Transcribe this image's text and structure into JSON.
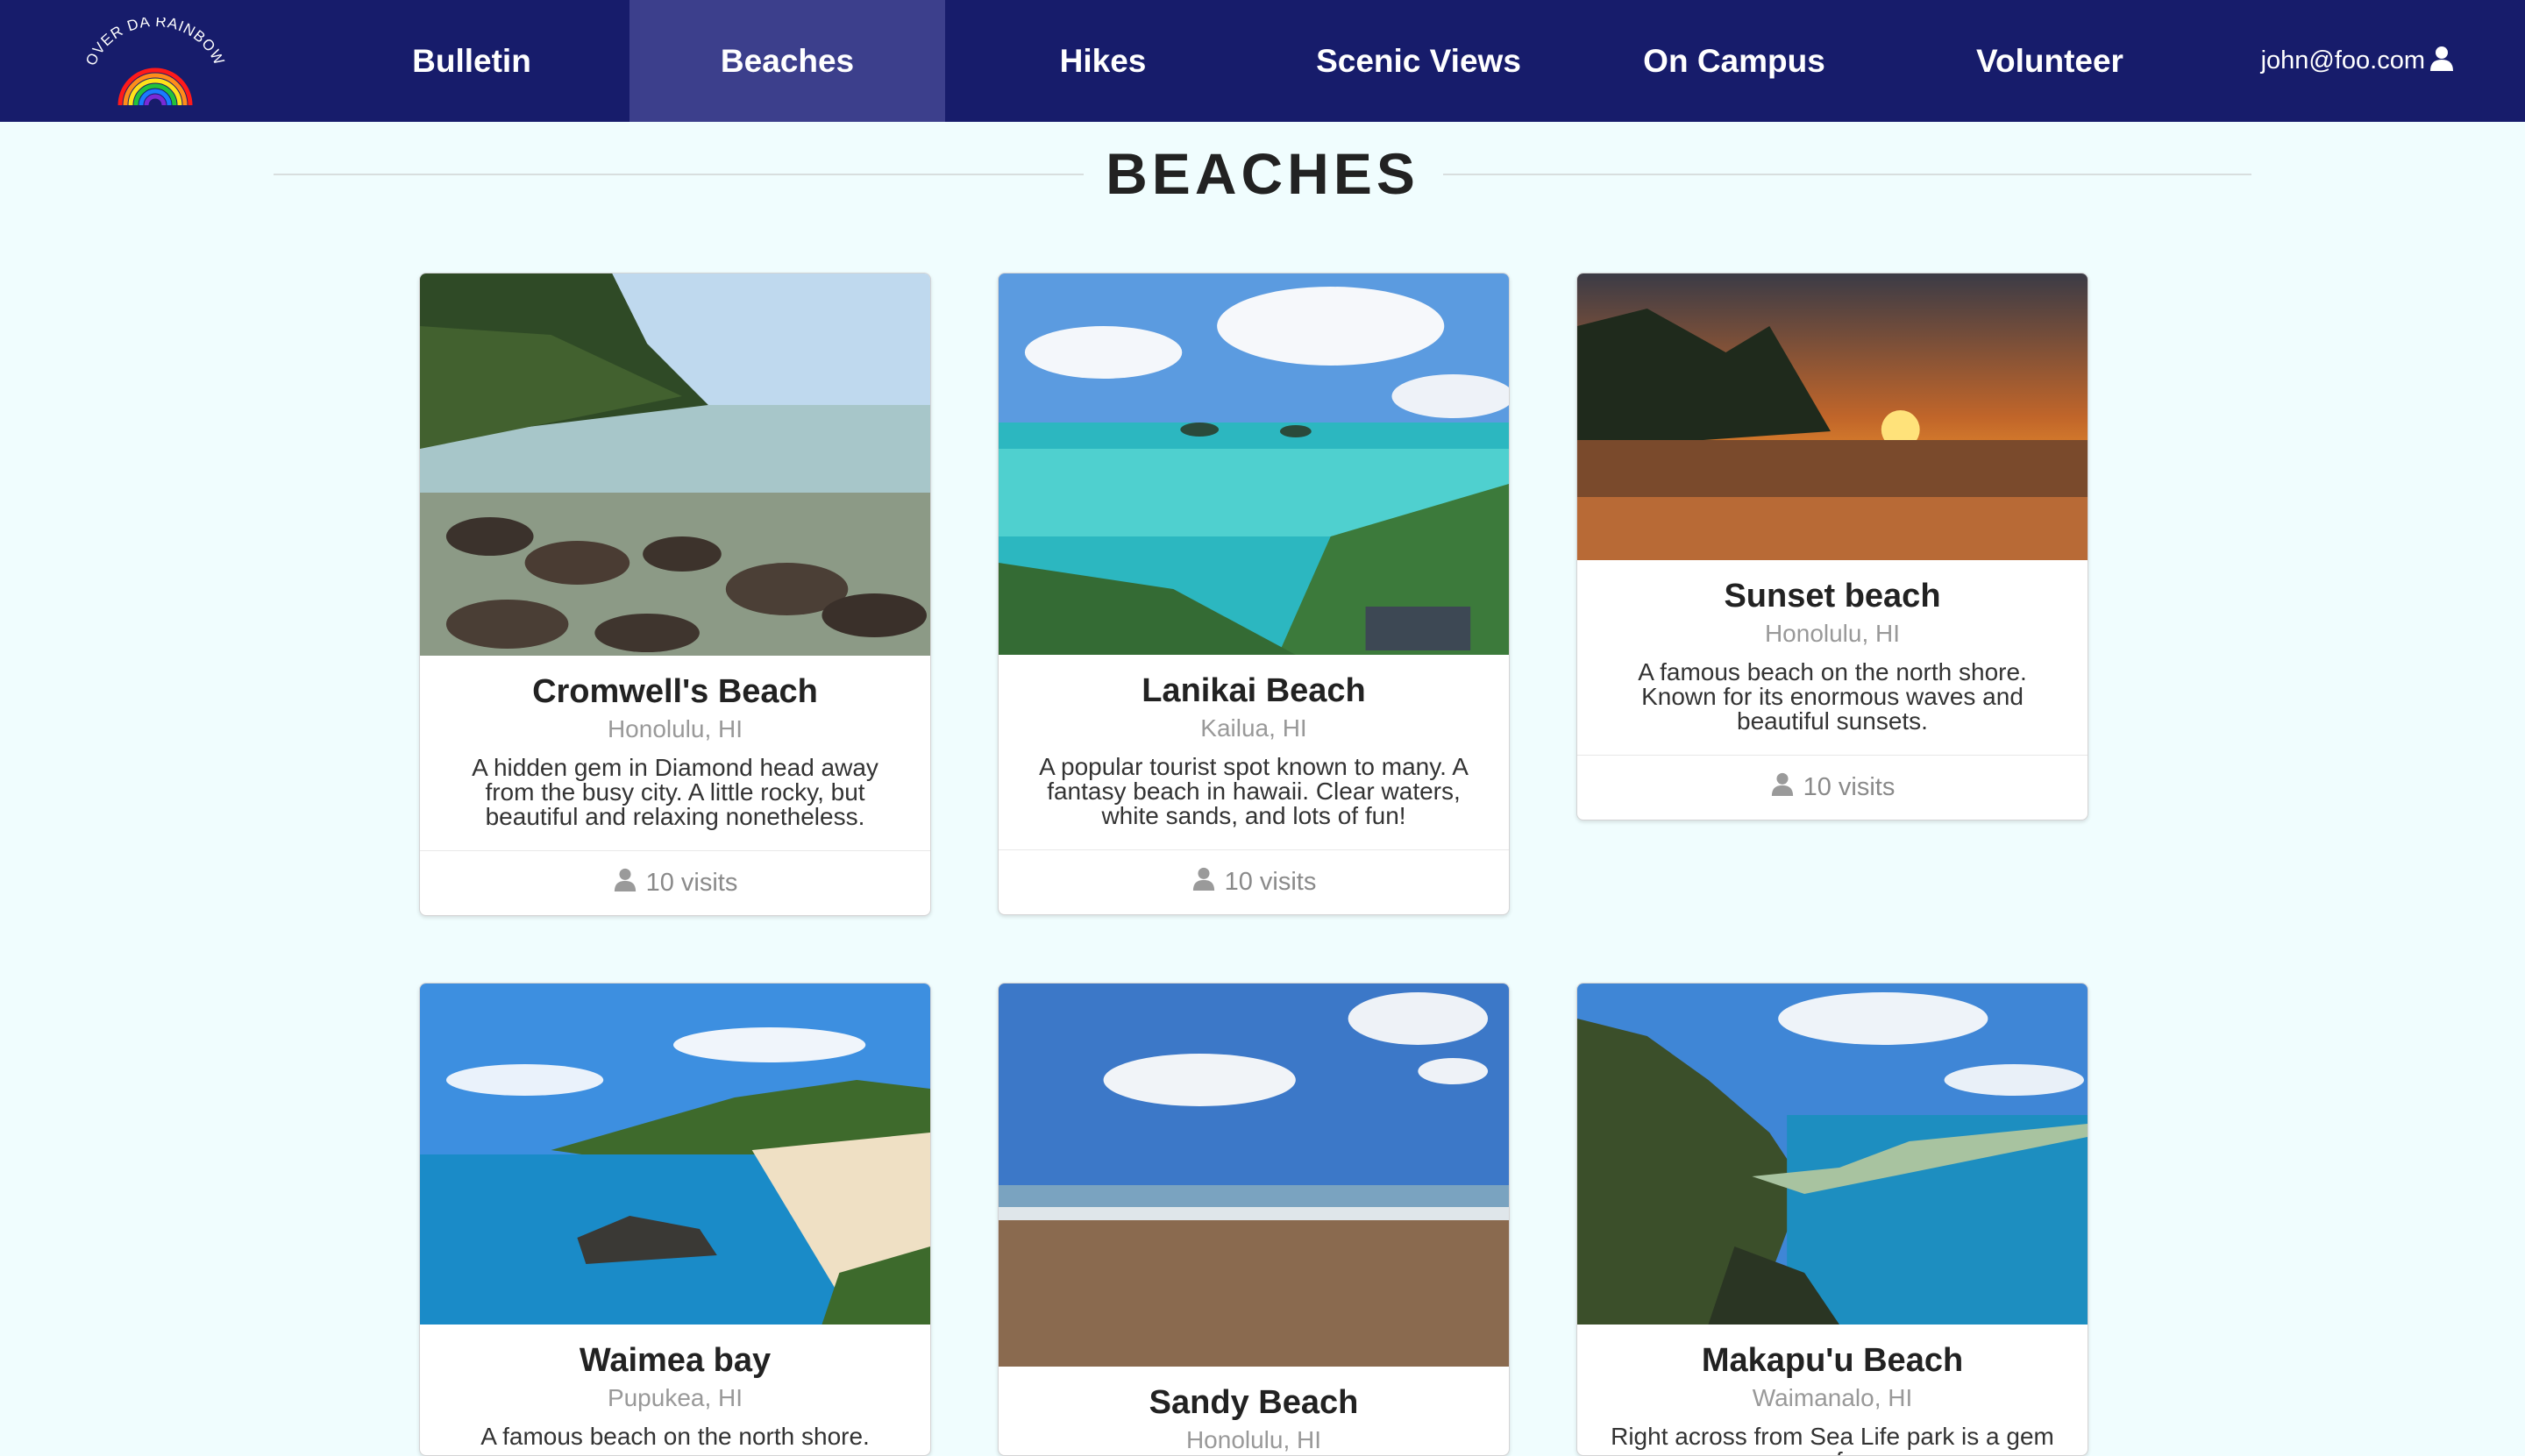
{
  "nav": {
    "logo_text": "OVER DA RAINBOW",
    "items": [
      {
        "label": "Bulletin",
        "active": false
      },
      {
        "label": "Beaches",
        "active": true
      },
      {
        "label": "Hikes",
        "active": false
      },
      {
        "label": "Scenic Views",
        "active": false
      },
      {
        "label": "On Campus",
        "active": false
      },
      {
        "label": "Volunteer",
        "active": false
      }
    ],
    "user_email": "john@foo.com",
    "user_icon": "user-icon"
  },
  "page": {
    "title": "BEACHES"
  },
  "cards": [
    {
      "title": "Cromwell's Beach",
      "location": "Honolulu, HI",
      "description": "A hidden gem in Diamond head away from the busy city. A little rocky, but beautiful and relaxing nonetheless.",
      "visits": "10 visits",
      "image": "rocky-beach-photo"
    },
    {
      "title": "Lanikai Beach",
      "location": "Kailua, HI",
      "description": "A popular tourist spot known to many. A fantasy beach in hawaii. Clear waters, white sands, and lots of fun!",
      "visits": "10 visits",
      "image": "aerial-beach-photo"
    },
    {
      "title": "Sunset beach",
      "location": "Honolulu, HI",
      "description": "A famous beach on the north shore. Known for its enormous waves and beautiful sunsets.",
      "visits": "10 visits",
      "image": "sunset-beach-photo"
    },
    {
      "title": "Waimea bay",
      "location": "Pupukea, HI",
      "description": "A famous beach on the north shore.",
      "image": "bay-photo"
    },
    {
      "title": "Sandy Beach",
      "location": "Honolulu, HI",
      "image": "sand-beach-photo"
    },
    {
      "title": "Makapu'u Beach",
      "location": "Waimanalo, HI",
      "description": "Right across from Sea Life park is a gem of",
      "image": "coast-cliff-photo"
    }
  ],
  "colors": {
    "navbar": "#171c6b",
    "navbar_active": "#3c3f8c",
    "page_bg": "#f0fdfe"
  }
}
